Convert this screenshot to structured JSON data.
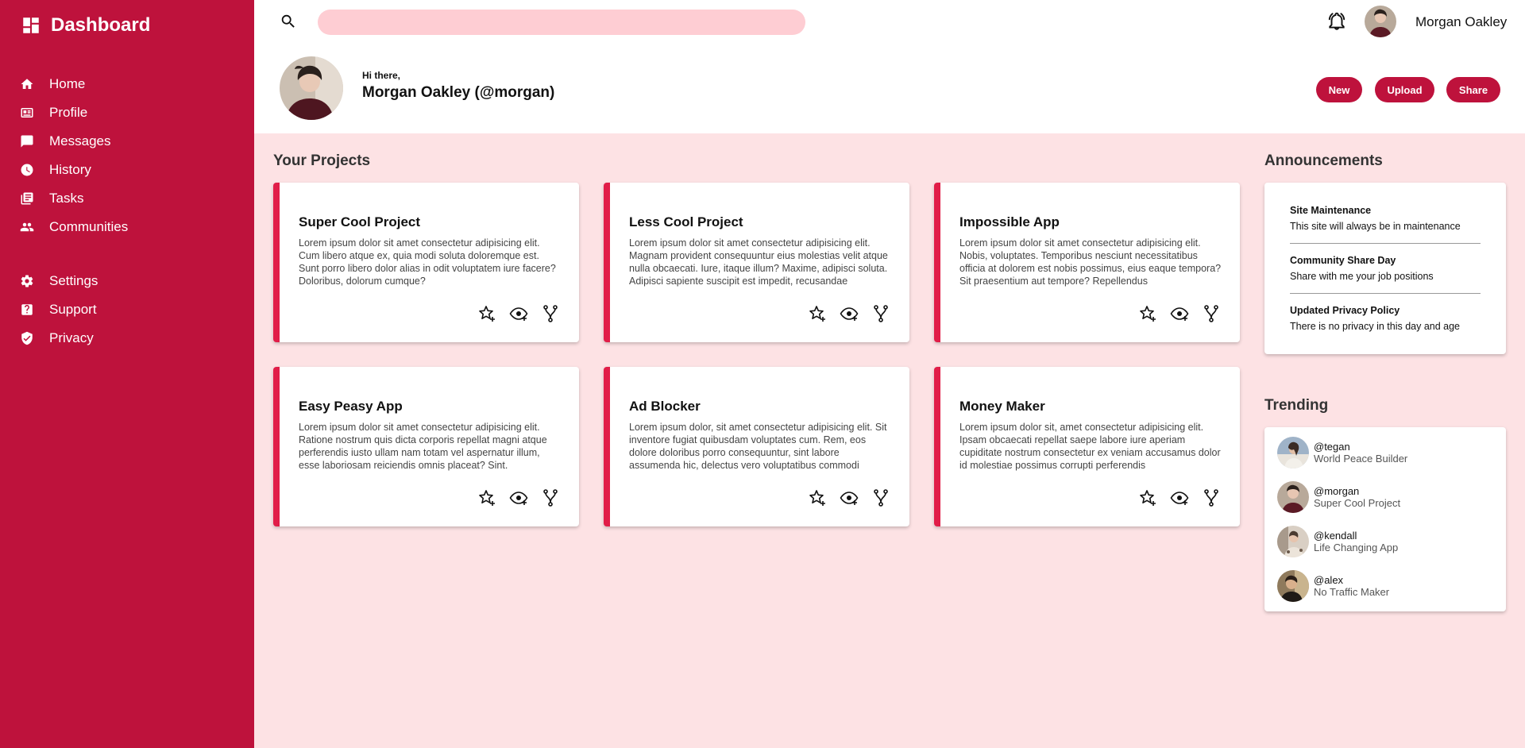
{
  "brand": {
    "title": "Dashboard"
  },
  "sidebar": {
    "items": [
      {
        "label": "Home",
        "icon": "home-icon"
      },
      {
        "label": "Profile",
        "icon": "id-card-icon"
      },
      {
        "label": "Messages",
        "icon": "chat-icon"
      },
      {
        "label": "History",
        "icon": "clock-icon"
      },
      {
        "label": "Tasks",
        "icon": "document-icon"
      },
      {
        "label": "Communities",
        "icon": "people-icon"
      },
      {
        "label": "Settings",
        "icon": "gear-icon"
      },
      {
        "label": "Support",
        "icon": "help-icon"
      },
      {
        "label": "Privacy",
        "icon": "shield-icon"
      }
    ]
  },
  "header": {
    "search_placeholder": "",
    "user_name": "Morgan Oakley"
  },
  "welcome": {
    "greeting": "Hi there,",
    "full_name": "Morgan Oakley (@morgan)",
    "buttons": {
      "new": "New",
      "upload": "Upload",
      "share": "Share"
    }
  },
  "projects": {
    "title": "Your Projects",
    "items": [
      {
        "title": "Super Cool Project",
        "desc": "Lorem ipsum dolor sit amet consectetur adipisicing elit. Cum libero atque ex, quia modi soluta doloremque est. Sunt porro libero dolor alias in odit voluptatem iure facere? Doloribus, dolorum cumque?"
      },
      {
        "title": "Less Cool Project",
        "desc": "Lorem ipsum dolor sit amet consectetur adipisicing elit. Magnam provident consequuntur eius molestias velit atque nulla obcaecati. Iure, itaque illum? Maxime, adipisci soluta. Adipisci sapiente suscipit est impedit, recusandae"
      },
      {
        "title": "Impossible App",
        "desc": "Lorem ipsum dolor sit amet consectetur adipisicing elit. Nobis, voluptates. Temporibus nesciunt necessitatibus officia at dolorem est nobis possimus, eius eaque tempora? Sit praesentium aut tempore? Repellendus"
      },
      {
        "title": "Easy Peasy App",
        "desc": "Lorem ipsum dolor sit amet consectetur adipisicing elit. Ratione nostrum quis dicta corporis repellat magni atque perferendis iusto ullam nam totam vel aspernatur illum, esse laboriosam reiciendis omnis placeat? Sint."
      },
      {
        "title": "Ad Blocker",
        "desc": "Lorem ipsum dolor, sit amet consectetur adipisicing elit. Sit inventore fugiat quibusdam voluptates cum. Rem, eos dolore doloribus porro consequuntur, sint labore assumenda hic, delectus vero voluptatibus commodi"
      },
      {
        "title": "Money Maker",
        "desc": "Lorem ipsum dolor sit, amet consectetur adipisicing elit. Ipsam obcaecati repellat saepe labore iure aperiam cupiditate nostrum consectetur ex veniam accusamus dolor id molestiae possimus corrupti perferendis"
      }
    ]
  },
  "announcements": {
    "title": "Announcements",
    "items": [
      {
        "title": "Site Maintenance",
        "text": "This site will always be in maintenance"
      },
      {
        "title": "Community Share Day",
        "text": "Share with me your job positions"
      },
      {
        "title": "Updated Privacy Policy",
        "text": "There is no privacy in this day and age"
      }
    ]
  },
  "trending": {
    "title": "Trending",
    "items": [
      {
        "handle": "@tegan",
        "project": "World Peace Builder"
      },
      {
        "handle": "@morgan",
        "project": "Super Cool Project"
      },
      {
        "handle": "@kendall",
        "project": "Life Changing App"
      },
      {
        "handle": "@alex",
        "project": "No Traffic Maker"
      }
    ]
  },
  "colors": {
    "brand": "#be123c",
    "accent": "#e11d48",
    "background": "#fde2e4",
    "search": "#fecdd3"
  }
}
